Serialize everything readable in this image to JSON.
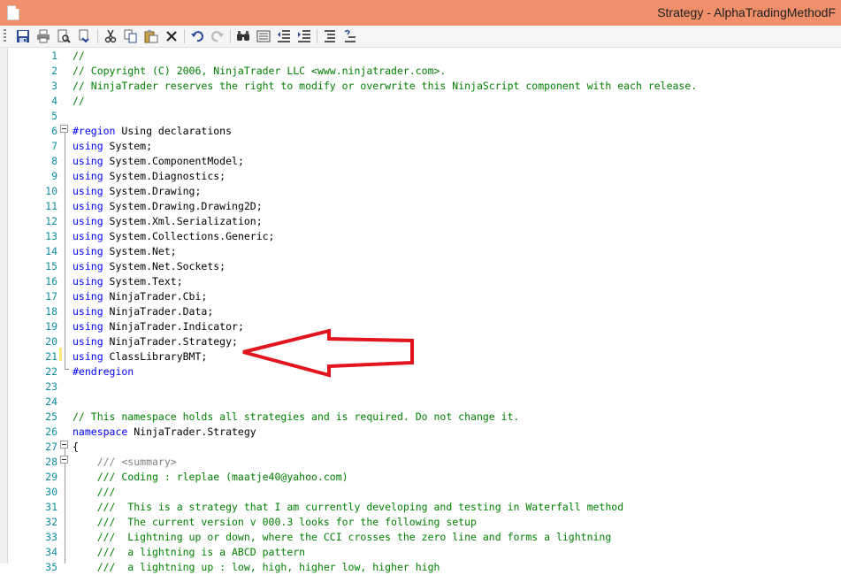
{
  "window": {
    "title": "Strategy - AlphaTradingMethodF"
  },
  "toolbar": [
    {
      "name": "save-icon",
      "tooltip": "Save"
    },
    {
      "name": "print-icon",
      "tooltip": "Print"
    },
    {
      "name": "print-preview-icon",
      "tooltip": "Print Preview"
    },
    {
      "name": "page-setup-icon",
      "tooltip": "Page Setup"
    },
    {
      "name": "cut-icon",
      "tooltip": "Cut"
    },
    {
      "name": "copy-icon",
      "tooltip": "Copy"
    },
    {
      "name": "paste-icon",
      "tooltip": "Paste"
    },
    {
      "name": "delete-icon",
      "tooltip": "Delete"
    },
    {
      "name": "undo-icon",
      "tooltip": "Undo"
    },
    {
      "name": "redo-icon",
      "tooltip": "Redo"
    },
    {
      "name": "find-icon",
      "tooltip": "Find"
    },
    {
      "name": "replace-icon",
      "tooltip": "Replace"
    },
    {
      "name": "outdent-icon",
      "tooltip": "Decrease Indent"
    },
    {
      "name": "indent-icon",
      "tooltip": "Increase Indent"
    },
    {
      "name": "comment-icon",
      "tooltip": "Comment"
    },
    {
      "name": "uncomment-icon",
      "tooltip": "Uncomment"
    }
  ],
  "editor": {
    "lines": [
      {
        "n": "1",
        "t": "//",
        "k": "cmt"
      },
      {
        "n": "2",
        "t": "// Copyright (C) 2006, NinjaTrader LLC <www.ninjatrader.com>.",
        "k": "cmt"
      },
      {
        "n": "3",
        "t": "// NinjaTrader reserves the right to modify or overwrite this NinjaScript component with each release.",
        "k": "cmt"
      },
      {
        "n": "4",
        "t": "//",
        "k": "cmt"
      },
      {
        "n": "5",
        "t": "",
        "k": "plain"
      },
      {
        "n": "6",
        "t": "#region Using declarations",
        "k": "region"
      },
      {
        "n": "7",
        "t": "using System;",
        "k": "using"
      },
      {
        "n": "8",
        "t": "using System.ComponentModel;",
        "k": "using"
      },
      {
        "n": "9",
        "t": "using System.Diagnostics;",
        "k": "using"
      },
      {
        "n": "10",
        "t": "using System.Drawing;",
        "k": "using"
      },
      {
        "n": "11",
        "t": "using System.Drawing.Drawing2D;",
        "k": "using"
      },
      {
        "n": "12",
        "t": "using System.Xml.Serialization;",
        "k": "using"
      },
      {
        "n": "13",
        "t": "using System.Collections.Generic;",
        "k": "using"
      },
      {
        "n": "14",
        "t": "using System.Net;",
        "k": "using"
      },
      {
        "n": "15",
        "t": "using System.Net.Sockets;",
        "k": "using"
      },
      {
        "n": "16",
        "t": "using System.Text;",
        "k": "using"
      },
      {
        "n": "17",
        "t": "using NinjaTrader.Cbi;",
        "k": "using"
      },
      {
        "n": "18",
        "t": "using NinjaTrader.Data;",
        "k": "using"
      },
      {
        "n": "19",
        "t": "using NinjaTrader.Indicator;",
        "k": "using"
      },
      {
        "n": "20",
        "t": "using NinjaTrader.Strategy;",
        "k": "using"
      },
      {
        "n": "21",
        "t": "using ClassLibraryBMT;",
        "k": "using"
      },
      {
        "n": "22",
        "t": "#endregion",
        "k": "kwline"
      },
      {
        "n": "23",
        "t": "",
        "k": "plain"
      },
      {
        "n": "24",
        "t": "",
        "k": "plain"
      },
      {
        "n": "25",
        "t": "// This namespace holds all strategies and is required. Do not change it.",
        "k": "cmt"
      },
      {
        "n": "26",
        "t": "namespace NinjaTrader.Strategy",
        "k": "namespace"
      },
      {
        "n": "27",
        "t": "{",
        "k": "plain"
      },
      {
        "n": "28",
        "t": "    /// <summary>",
        "k": "doc"
      },
      {
        "n": "29",
        "t": "    /// Coding : rleplae (maatje40@yahoo.com)",
        "k": "doc"
      },
      {
        "n": "30",
        "t": "    ///",
        "k": "doc"
      },
      {
        "n": "31",
        "t": "    ///  This is a strategy that I am currently developing and testing in Waterfall method",
        "k": "doc"
      },
      {
        "n": "32",
        "t": "    ///  The current version v 000.3 looks for the following setup",
        "k": "doc"
      },
      {
        "n": "33",
        "t": "    ///  Lightning up or down, where the CCI crosses the zero line and forms a lightning",
        "k": "doc"
      },
      {
        "n": "34",
        "t": "    ///  a lightning is a ABCD pattern",
        "k": "doc"
      },
      {
        "n": "35",
        "t": "    ///  a lightning up : low, high, higher low, higher high",
        "k": "doc"
      }
    ]
  }
}
